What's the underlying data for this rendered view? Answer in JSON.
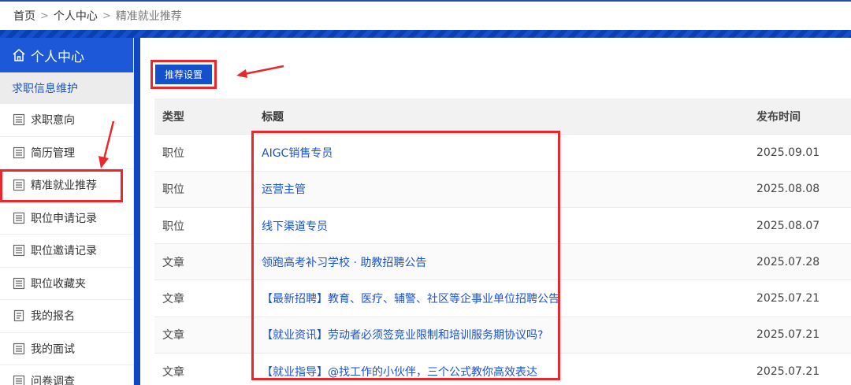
{
  "breadcrumb": {
    "home": "首页",
    "center": "个人中心",
    "current": "精准就业推荐"
  },
  "sidebar": {
    "title": "个人中心",
    "section": "求职信息维护",
    "items": [
      {
        "label": "求职意向",
        "icon": "document-icon"
      },
      {
        "label": "简历管理",
        "icon": "document-icon"
      },
      {
        "label": "精准就业推荐",
        "icon": "document-icon"
      },
      {
        "label": "职位申请记录",
        "icon": "document-icon"
      },
      {
        "label": "职位邀请记录",
        "icon": "document-icon"
      },
      {
        "label": "职位收藏夹",
        "icon": "document-icon"
      },
      {
        "label": "我的报名",
        "icon": "clipboard-icon"
      },
      {
        "label": "我的面试",
        "icon": "document-icon"
      },
      {
        "label": "问卷调查",
        "icon": "document-icon"
      }
    ]
  },
  "main": {
    "button": "推荐设置",
    "table": {
      "headers": {
        "type": "类型",
        "title": "标题",
        "date": "发布时间"
      },
      "rows": [
        {
          "type": "职位",
          "title": "AIGC销售专员",
          "date": "2025.09.01"
        },
        {
          "type": "职位",
          "title": "运营主管",
          "date": "2025.08.08"
        },
        {
          "type": "职位",
          "title": "线下渠道专员",
          "date": "2025.08.07"
        },
        {
          "type": "文章",
          "title": "领跑高考补习学校 · 助教招聘公告",
          "date": "2025.07.28"
        },
        {
          "type": "文章",
          "title": "【最新招聘】教育、医疗、辅警、社区等企事业单位招聘公告",
          "date": "2025.07.21"
        },
        {
          "type": "文章",
          "title": "【就业资讯】劳动者必须签竞业限制和培训服务期协议吗?",
          "date": "2025.07.21"
        },
        {
          "type": "文章",
          "title": "【就业指导】@找工作的小伙伴，三个公式教你高效表达",
          "date": "2025.07.21"
        }
      ]
    }
  },
  "colors": {
    "brand": "#1c58d8",
    "highlight": "#e8282b",
    "link": "#1a52d0"
  }
}
